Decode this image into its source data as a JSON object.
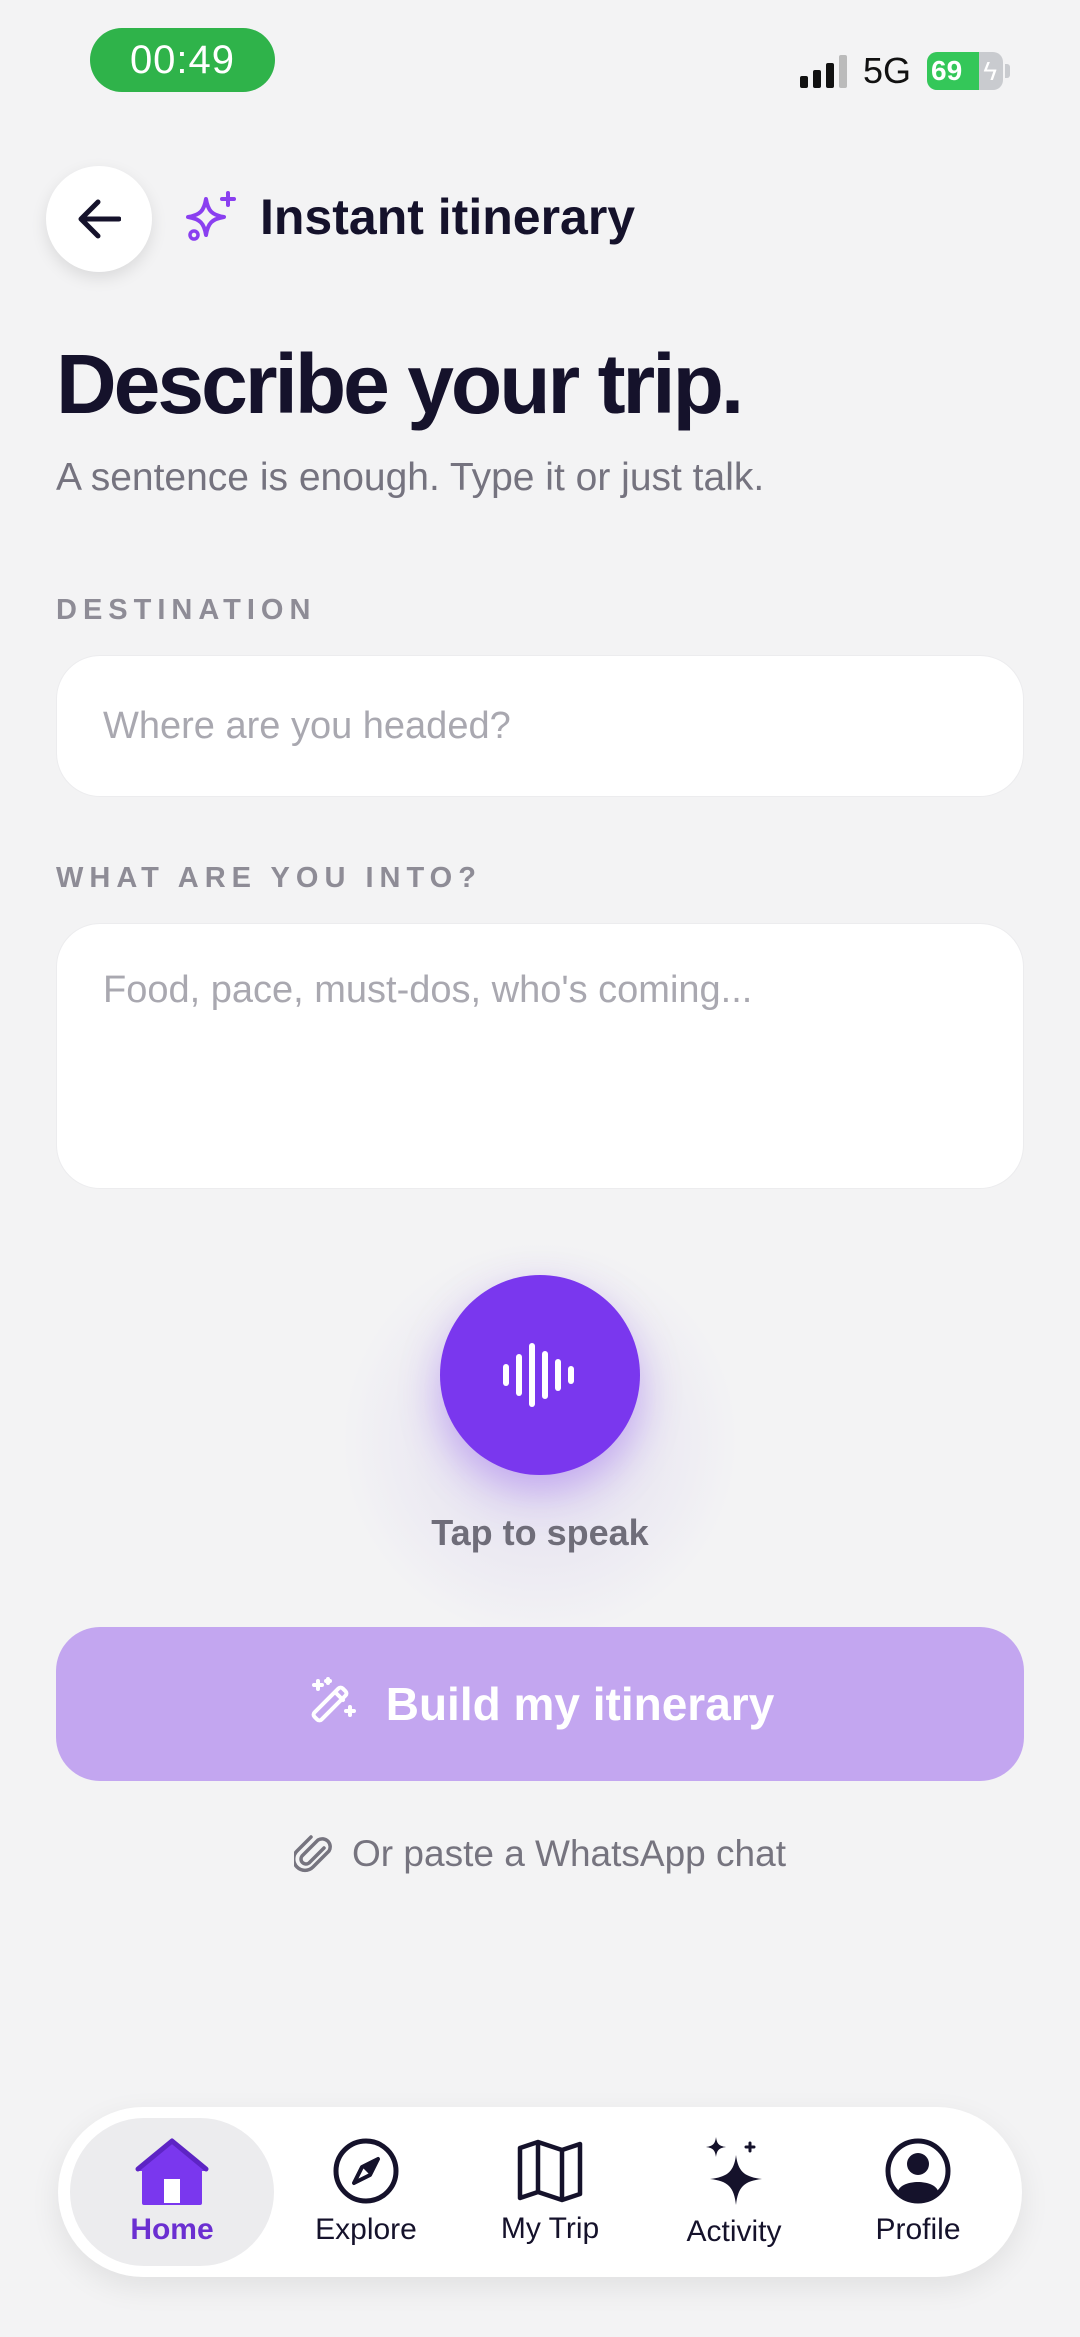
{
  "status_bar": {
    "time": "00:49",
    "network": "5G",
    "battery": "69"
  },
  "header": {
    "title": "Instant itinerary"
  },
  "hero": {
    "title": "Describe your trip.",
    "subtitle": "A sentence is enough. Type it or just talk."
  },
  "destination": {
    "label": "DESTINATION",
    "placeholder": "Where are you headed?",
    "value": ""
  },
  "interests": {
    "label": "WHAT ARE YOU INTO?",
    "placeholder": "Food, pace, must-dos, who's coming...",
    "value": ""
  },
  "voice": {
    "label": "Tap to speak"
  },
  "build": {
    "label": "Build my itinerary"
  },
  "paste": {
    "label": "Or paste a WhatsApp chat"
  },
  "nav": {
    "items": [
      {
        "label": "Home",
        "icon": "home-icon",
        "active": true
      },
      {
        "label": "Explore",
        "icon": "compass-icon",
        "active": false
      },
      {
        "label": "My Trip",
        "icon": "map-icon",
        "active": false
      },
      {
        "label": "Activity",
        "icon": "sparkle-icon",
        "active": false
      },
      {
        "label": "Profile",
        "icon": "profile-icon",
        "active": false
      }
    ]
  },
  "colors": {
    "accent": "#7a37ee",
    "button_disabled": "#c3a6f0",
    "nav_active": "#6b2fd1"
  }
}
